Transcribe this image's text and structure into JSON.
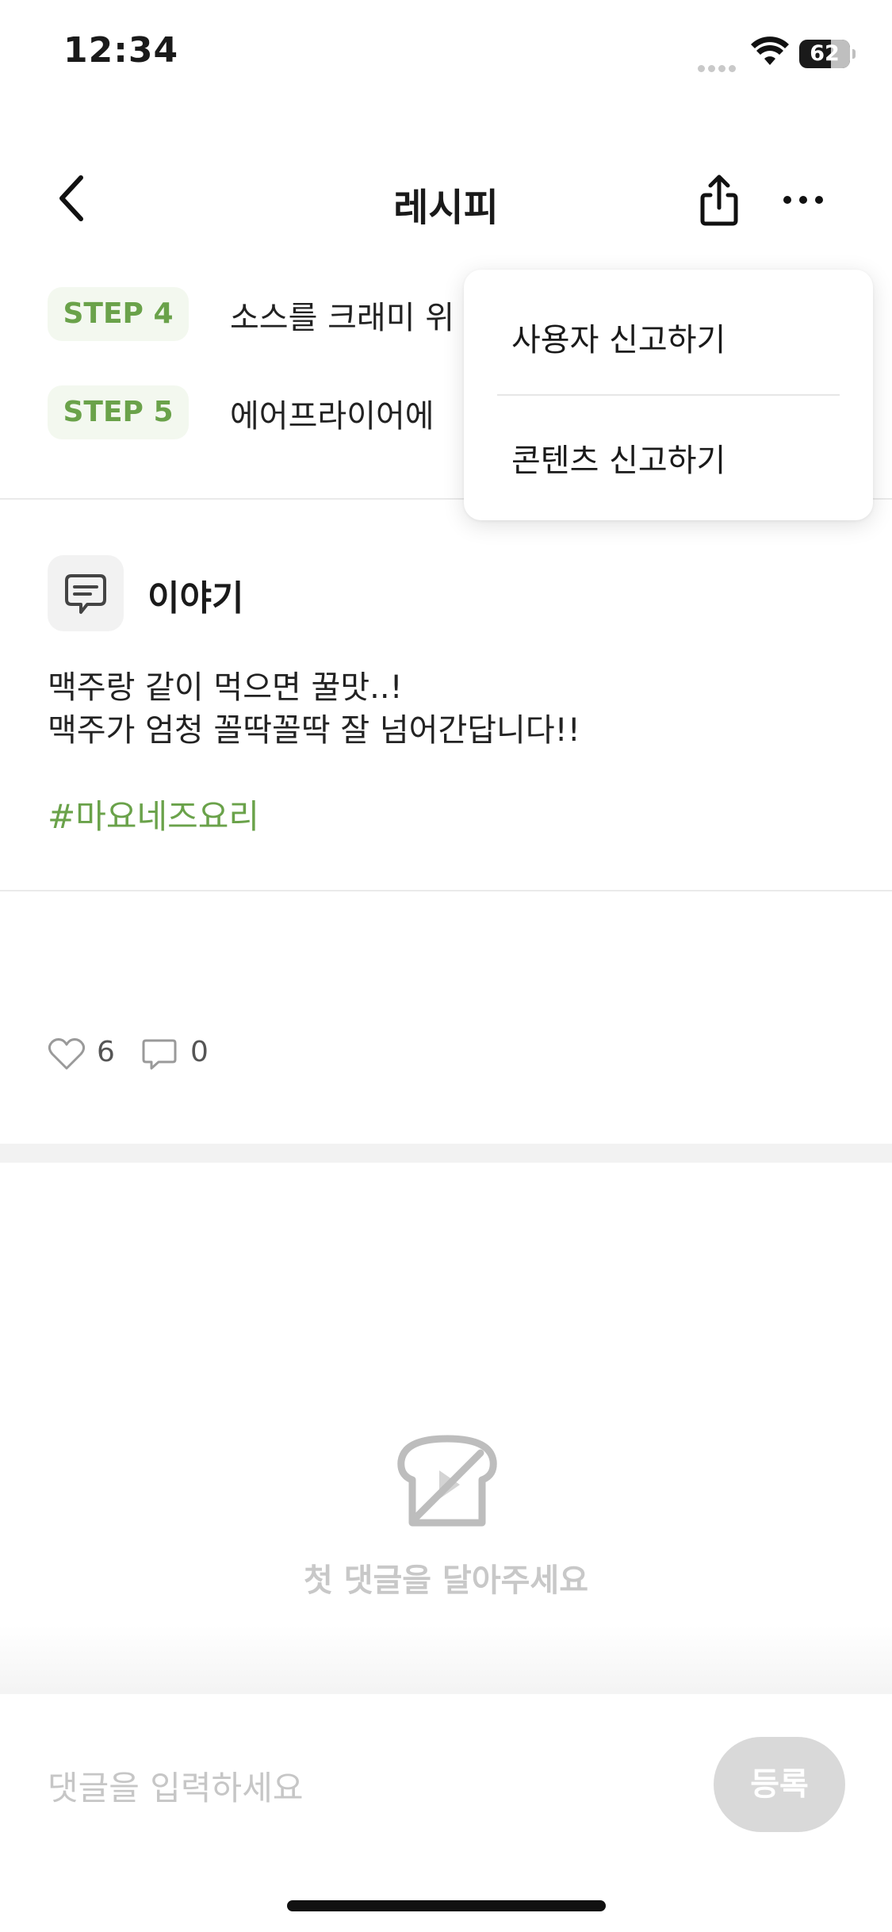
{
  "status_bar": {
    "time": "12:34",
    "battery_percent": "62",
    "icons": [
      "signal-dots-icon",
      "wifi-icon",
      "battery-icon"
    ]
  },
  "header": {
    "title": "레시피",
    "icons": [
      "back-chevron-icon",
      "share-icon",
      "more-icon"
    ]
  },
  "steps": [
    {
      "badge": "STEP 4",
      "text": "소스를 크래미 위"
    },
    {
      "badge": "STEP 5",
      "text": "에어프라이어에 "
    }
  ],
  "menu": {
    "items": [
      "사용자 신고하기",
      "콘텐츠 신고하기"
    ]
  },
  "story": {
    "title": "이야기",
    "lines": [
      "맥주랑 같이 먹으면 꿀맛..!",
      "맥주가 엄청 꼴딱꼴딱 잘 넘어간답니다!!"
    ],
    "hashtag": "#마요네즈요리"
  },
  "reactions": {
    "likes": "6",
    "comments": "0"
  },
  "empty_state": {
    "text": "첫 댓글을 달아주세요",
    "icon": "bread-slash-icon"
  },
  "comment_input": {
    "placeholder": "댓글을 입력하세요",
    "submit_label": "등록"
  },
  "colors": {
    "accent_green": "#6aa24a",
    "badge_bg": "#f3f8ef",
    "disabled_button": "#d9d9d9",
    "muted_text": "#c8c8c8"
  }
}
